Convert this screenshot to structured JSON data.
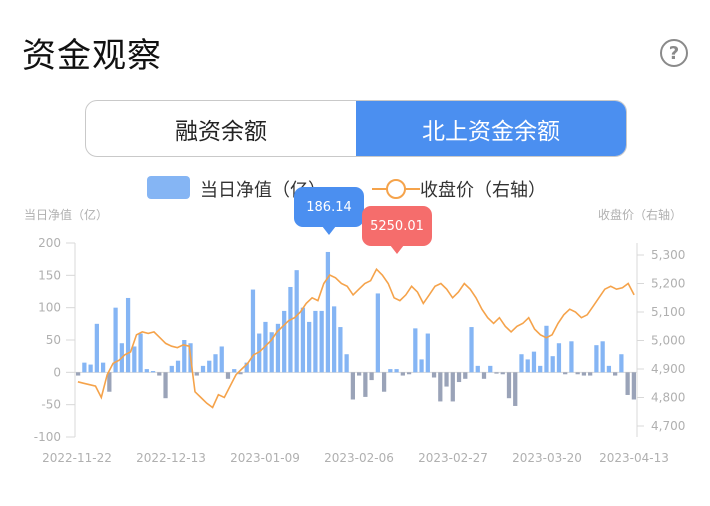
{
  "page": {
    "title": "资金观察",
    "help_icon": "question-circle-icon",
    "help_label": "?"
  },
  "tabs": [
    {
      "label": "融资余额",
      "active": false
    },
    {
      "label": "北上资金余额",
      "active": true
    }
  ],
  "legend": {
    "bar_label": "当日净值（亿）",
    "line_label": "收盘价（右轴）"
  },
  "tooltips": {
    "bar_value": "186.14",
    "line_value": "5250.01"
  },
  "colors": {
    "accent": "#4b8ff0",
    "bar_positive": "#85b5f4",
    "bar_negative": "#9aa3b8",
    "line": "#f5a34b",
    "tooltip_red": "#f56d6c"
  },
  "chart_data": {
    "type": "bar",
    "left_axis_title": "当日净值（亿）",
    "right_axis_title": "收盘价（右轴）",
    "y_left_ticks": [
      "200",
      "150",
      "100",
      "50",
      "0",
      "-50",
      "-100"
    ],
    "y_right_ticks": [
      "5,300",
      "5,200",
      "5,100",
      "5,000",
      "4,900",
      "4,800",
      "4,700"
    ],
    "ylim_left": [
      -100,
      200
    ],
    "ylim_right": [
      4700,
      5300
    ],
    "x_tick_labels": [
      "2022-11-22",
      "2022-12-13",
      "2023-01-09",
      "2023-02-06",
      "2023-02-27",
      "2023-03-20",
      "2023-04-13"
    ],
    "series": [
      {
        "name": "当日净值（亿）",
        "axis": "left",
        "values": [
          -5,
          15,
          12,
          75,
          15,
          -30,
          100,
          45,
          115,
          40,
          60,
          5,
          2,
          -5,
          -40,
          10,
          18,
          50,
          45,
          -5,
          10,
          18,
          28,
          40,
          -10,
          5,
          -3,
          15,
          128,
          60,
          78,
          62,
          75,
          95,
          132,
          158,
          100,
          78,
          95,
          95,
          186.14,
          102,
          70,
          28,
          -42,
          -5,
          -38,
          -12,
          122,
          -30,
          5,
          5,
          -5,
          -3,
          68,
          20,
          60,
          -8,
          -45,
          -22,
          -45,
          -15,
          -10,
          70,
          10,
          -10,
          10,
          -2,
          -3,
          -40,
          -52,
          28,
          20,
          32,
          10,
          72,
          25,
          45,
          -3,
          48,
          -3,
          -5,
          -5,
          42,
          48,
          10,
          -5,
          28,
          -35,
          -42
        ],
        "color": "#85b5f4",
        "negative_color": "#9aa3b8"
      },
      {
        "name": "收盘价（右轴）",
        "axis": "right",
        "type": "line",
        "values": [
          4855,
          4850,
          4845,
          4840,
          4800,
          4880,
          4920,
          4930,
          4950,
          4960,
          5020,
          5030,
          5025,
          5030,
          5010,
          4990,
          4980,
          4975,
          4985,
          4980,
          4820,
          4800,
          4780,
          4765,
          4810,
          4800,
          4840,
          4880,
          4900,
          4920,
          4950,
          4960,
          4980,
          5000,
          5030,
          5050,
          5070,
          5080,
          5100,
          5130,
          5150,
          5140,
          5200,
          5230,
          5220,
          5200,
          5190,
          5160,
          5180,
          5200,
          5210,
          5250.01,
          5230,
          5200,
          5150,
          5140,
          5160,
          5190,
          5170,
          5130,
          5160,
          5190,
          5200,
          5180,
          5150,
          5170,
          5200,
          5180,
          5150,
          5110,
          5080,
          5060,
          5080,
          5050,
          5030,
          5050,
          5060,
          5080,
          5040,
          5020,
          5010,
          5020,
          5060,
          5090,
          5110,
          5100,
          5080,
          5090,
          5120,
          5150,
          5180,
          5190,
          5180,
          5185,
          5200,
          5160
        ]
      }
    ]
  }
}
